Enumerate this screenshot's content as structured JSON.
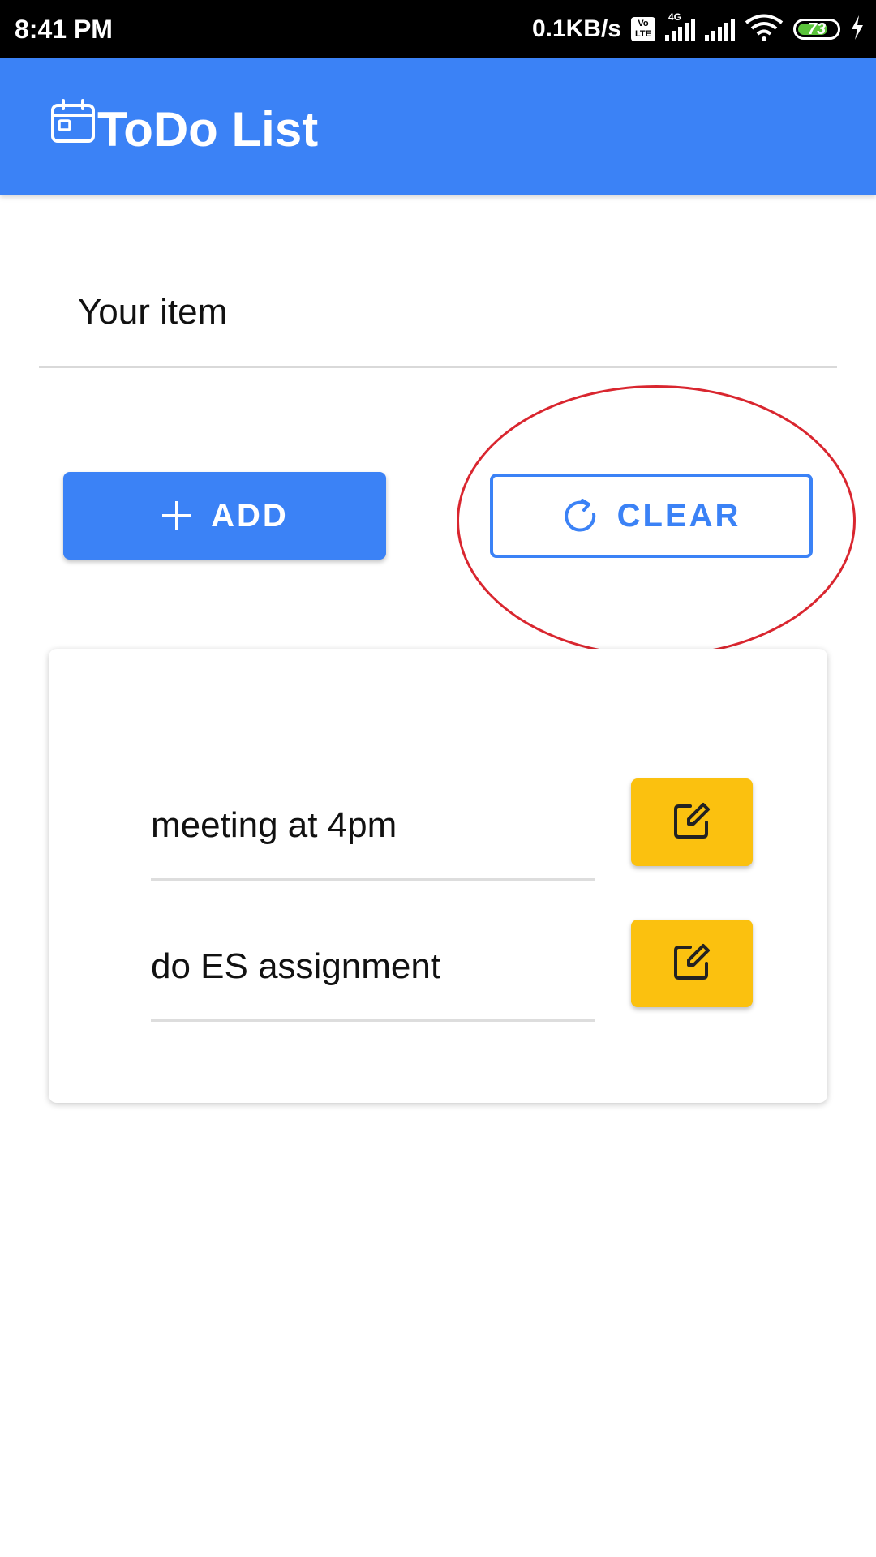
{
  "status_bar": {
    "time": "8:41 PM",
    "net_speed": "0.1KB/s",
    "volte_top": "Vo",
    "volte_bottom": "LTE",
    "network_type": "4G",
    "battery_level": "73"
  },
  "app_bar": {
    "title": "ToDo List",
    "icon": "calendar-icon",
    "background_color": "#3b82f6"
  },
  "input": {
    "placeholder": "Your item",
    "value": ""
  },
  "actions": {
    "add_label": "ADD",
    "add_icon": "plus-icon",
    "clear_label": "CLEAR",
    "clear_icon": "refresh-icon",
    "accent_color": "#3b82f6"
  },
  "todo_items": [
    {
      "text": "meeting at 4pm",
      "edit_icon": "edit-icon"
    },
    {
      "text": "do ES assignment",
      "edit_icon": "edit-icon"
    }
  ],
  "colors": {
    "edit_button": "#fbc10f",
    "highlight": "#d9262f"
  }
}
